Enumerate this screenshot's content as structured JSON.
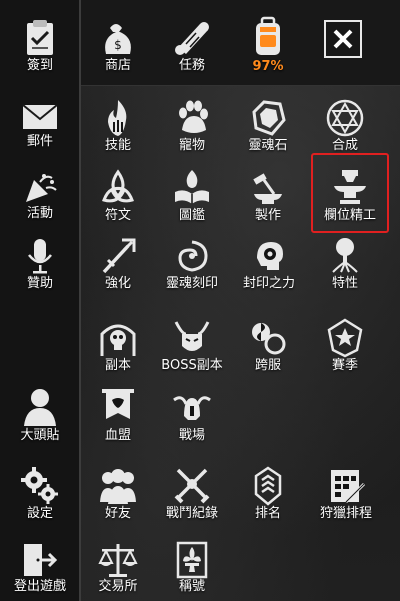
{
  "sidebar": {
    "checkin": "簽到",
    "mail": "郵件",
    "events": "活動",
    "sponsor": "贊助",
    "avatar": "大頭貼",
    "settings": "設定",
    "logout": "登出遊戲"
  },
  "top": {
    "shop": "商店",
    "tasks": "任務",
    "capacity_percent": "97%"
  },
  "grid": {
    "skills": "技能",
    "pets": "寵物",
    "soul_stone": "靈魂石",
    "synthesis": "合成",
    "runes": "符文",
    "codex": "圖鑑",
    "crafting": "製作",
    "slot_refine": "欄位精工",
    "enhance": "強化",
    "soul_engrave": "靈魂刻印",
    "seal_power": "封印之力",
    "traits": "特性",
    "dungeon": "副本",
    "boss_dungeon": "BOSS副本",
    "cross_server": "跨服",
    "season": "賽季",
    "blood_alliance": "血盟",
    "battlefield": "戰場",
    "friends": "好友",
    "battle_log": "戰鬥紀錄",
    "ranking": "排名",
    "hunt_schedule": "狩獵排程",
    "exchange": "交易所",
    "titles": "稱號"
  },
  "colors": {
    "accent_orange": "#ff8a1c",
    "highlight_red": "#e02020"
  }
}
